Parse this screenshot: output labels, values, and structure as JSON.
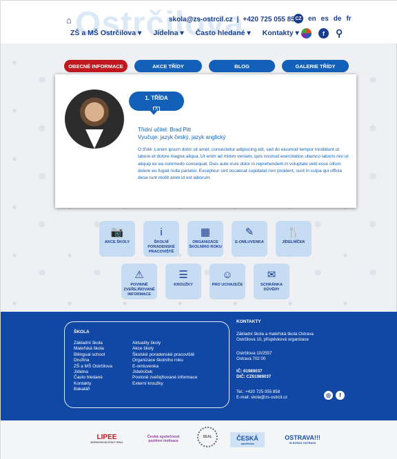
{
  "header": {
    "watermark": "Ostrčilova",
    "email": "skola@zs-ostrcil.cz",
    "separator": "|",
    "phone": "+420 725 055 858",
    "languages": [
      "en",
      "es",
      "de",
      "fr"
    ],
    "cz_badge": "CZ",
    "nav": [
      "ZŠ a MŠ Ostrčilova ▾",
      "Jídelna ▾",
      "Často hledané ▾",
      "Kontakty ▾"
    ]
  },
  "tabs": [
    {
      "label": "OBECNÉ INFORMACE",
      "active": true
    },
    {
      "label": "AKCE TŘÍDY",
      "active": false
    },
    {
      "label": "BLOG",
      "active": false
    },
    {
      "label": "GALERIE TŘÍDY",
      "active": false
    }
  ],
  "class_card": {
    "class_name": "1. TŘÍDA",
    "class_letter": "A",
    "teacher": "Třídní učitel: Brad Pitt",
    "subjects": "Vyučuje: jazyk český, jazyk anglický",
    "description": "O třídě: Lorem ipsum dolor sit amet, consectetur adipiscing elit, sed do eiusmod tempor incididunt ut labore et dolore magna aliqua. Ut enim ad minim veniam, quis nostrud exercitation ullamco laboris nisi ut aliquip ex ea commodo consequat. Duis aute irure dolor in reprehenderit in voluptate velit esse cillum dolore eu fugiat nulla pariatur. Excepteur sint occaecat cupidatat non proident, sunt in culpa qui officia dese-runt mollit anim id est laborum."
  },
  "quick_links": [
    {
      "icon": "camera-icon",
      "glyph": "📷",
      "label": "AKCE ŠKOLY"
    },
    {
      "icon": "info-icon",
      "glyph": "i",
      "label": "ŠKOLNÍ PORADENSKÉ PRACOVIŠTĚ"
    },
    {
      "icon": "calendar-icon",
      "glyph": "▦",
      "label": "ORGANIZACE ŠKOLNÍHO ROKU"
    },
    {
      "icon": "edit-icon",
      "glyph": "✎",
      "label": "E-OMLUVENKA"
    },
    {
      "icon": "cutlery-icon",
      "glyph": "🍴",
      "label": "JÍDELNÍČEK"
    },
    {
      "icon": "warning-icon",
      "glyph": "⚠",
      "label": "POVINNĚ ZVEŘEJŇOVANÉ INFORMACE"
    },
    {
      "icon": "list-icon",
      "glyph": "☰",
      "label": "KROUŽKY"
    },
    {
      "icon": "smile-icon",
      "glyph": "☺",
      "label": "PRO UCHAZEČE"
    },
    {
      "icon": "mail-icon",
      "glyph": "✉",
      "label": "SCHRÁNKA DŮVĚRY"
    }
  ],
  "footer": {
    "school_heading": "ŠKOLA",
    "col1": [
      "Základní škola",
      "Mateřská škola",
      "Bilingual school",
      "Družina",
      "ZŠ a MŠ Ostrčilova",
      "Jídelna",
      "Často hledané",
      "Kontakty",
      "Bakaláři"
    ],
    "col2": [
      "Aktuality školy",
      "Akce školy",
      "Školské poradenské pracoviště",
      "Organizace školního roku",
      "E-omluvenka",
      "Jídelníček",
      "Povinně zveřejňované informace",
      "Externí kroužky"
    ],
    "contacts_heading": "KONTAKTY",
    "org_line1": "Základní škola a mateřská škola Ostrava",
    "org_line2": "Ostrčilova 10, příspěvková organizace",
    "addr_line1": "Ostrčilova 10/2557",
    "addr_line2": "Ostrava 702 00",
    "ic": "IČ: 61989037",
    "dic": "DIČ: CZ61989037",
    "tel": "Tel.: +420 725 055 858",
    "mail": "E-mail: skola@zs-ostrcil.cz"
  },
  "partners": [
    {
      "name": "LIPEE",
      "sub": "MORAVSKOSLEZSKÝ KRAJ",
      "color": "#c0181f"
    },
    {
      "name": "Česká společnost",
      "sub": "pozitivní motivace",
      "color": "#8a3fa0"
    },
    {
      "name": "SEAL",
      "sub": "",
      "color": "#555555"
    },
    {
      "name": "ČESKÁ",
      "sub": "spořitelna",
      "color": "#1a4fa0"
    },
    {
      "name": "OSTRAVA!!!",
      "sub": "SLEZSKÁ OSTRAVA",
      "color": "#1a4fa0"
    }
  ],
  "colors": {
    "brand_blue": "#1360b8",
    "active_red": "#c0181f",
    "footer_blue": "#1148a6",
    "tile_blue": "#c6dcf2"
  }
}
